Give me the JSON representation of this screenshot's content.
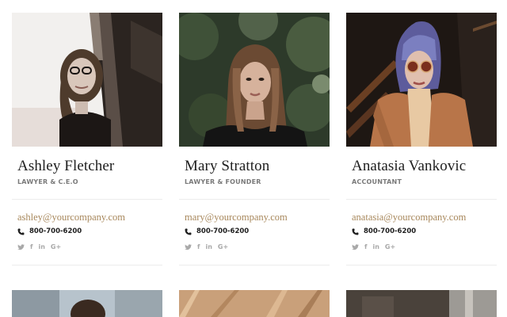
{
  "team": [
    {
      "name": "Ashley Fletcher",
      "role": "LAWYER & C.E.O",
      "email": "ashley@yourcompany.com",
      "phone": "800-700-6200",
      "photo": "woman-with-glasses-photo",
      "socials": [
        "twitter-icon",
        "facebook-icon",
        "linkedin-icon",
        "google-plus-icon"
      ]
    },
    {
      "name": "Mary Stratton",
      "role": "LAWYER & FOUNDER",
      "email": "mary@yourcompany.com",
      "phone": "800-700-6200",
      "photo": "woman-long-hair-photo",
      "socials": [
        "twitter-icon",
        "facebook-icon",
        "linkedin-icon",
        "google-plus-icon"
      ]
    },
    {
      "name": "Anatasia Vankovic",
      "role": "ACCOUNTANT",
      "email": "anatasia@yourcompany.com",
      "phone": "800-700-6200",
      "photo": "woman-purple-hair-photo",
      "socials": [
        "twitter-icon",
        "facebook-icon",
        "linkedin-icon",
        "google-plus-icon"
      ]
    }
  ],
  "social_labels": {
    "facebook": "f",
    "linkedin": "in",
    "googleplus": "G+"
  },
  "colors": {
    "email_link": "#a7875b",
    "role_text": "#7a7a7a",
    "social_icon": "#a9a9a9",
    "divider": "#ececec"
  }
}
